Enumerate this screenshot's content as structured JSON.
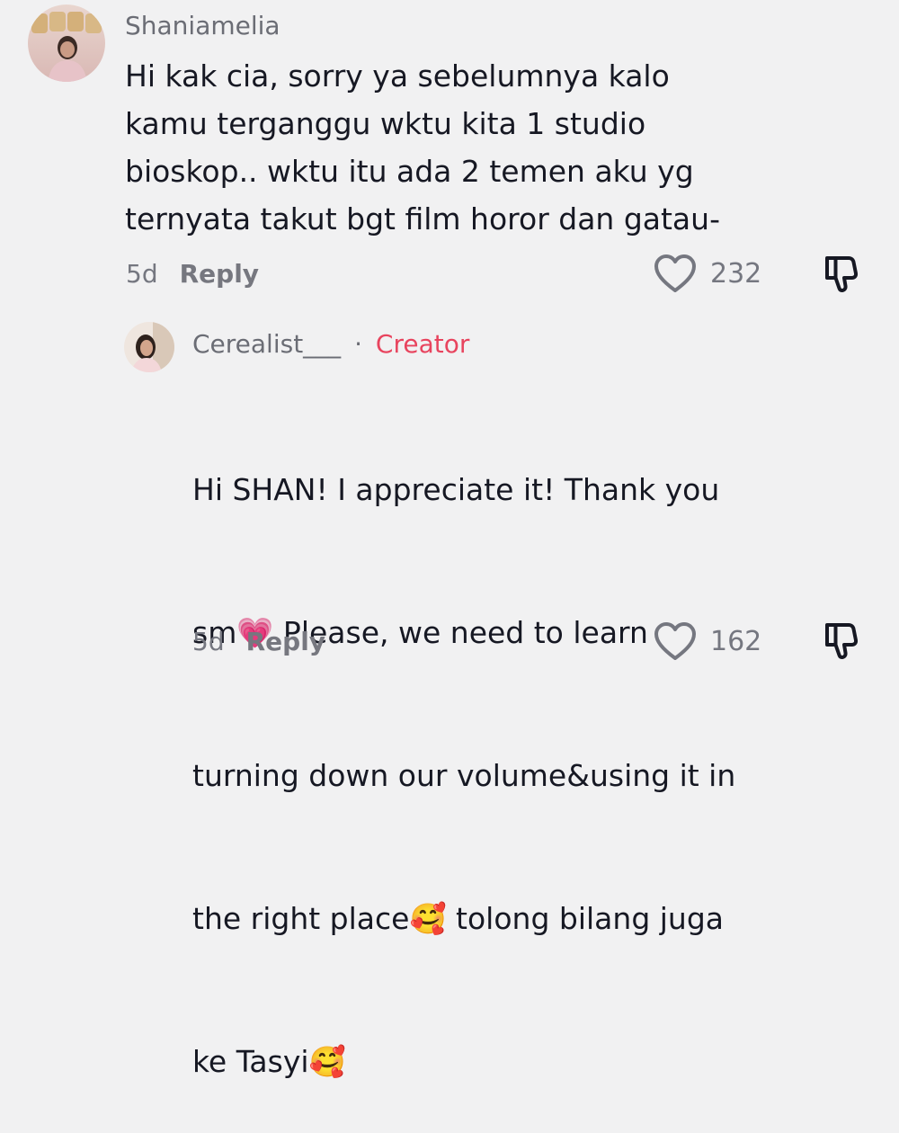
{
  "comment": {
    "username": "Shaniamelia",
    "text": "Hi kak cia, sorry ya sebelumnya kalo\nkamu terganggu wktu kita 1 studio\nbioskop.. wktu itu ada 2 temen aku yg\nternyata takut bgt film horor dan gatau-",
    "time": "5d",
    "reply_label": "Reply",
    "likes": "232"
  },
  "reply": {
    "username": "Cerealist___",
    "separator": "·",
    "badge": "Creator",
    "line1": "Hi SHAN! I appreciate it! Thank you",
    "line2a": "sm",
    "emoji_heart": "💗",
    "line2b": " Please, we need to learn",
    "line3": "turning down our volume&using it in",
    "line4a": "the right place",
    "emoji_smile": "🥰",
    "line4b": " tolong bilang juga",
    "line5a": "ke Tasyi",
    "emoji_smile2": "🥰",
    "time": "5d",
    "reply_label": "Reply",
    "likes": "162"
  },
  "colors": {
    "background": "#f1f1f2",
    "creator_badge": "#e8445e",
    "text": "#161823",
    "muted": "#757780"
  },
  "icons": [
    "heart-outline-icon",
    "thumbs-down-icon"
  ]
}
